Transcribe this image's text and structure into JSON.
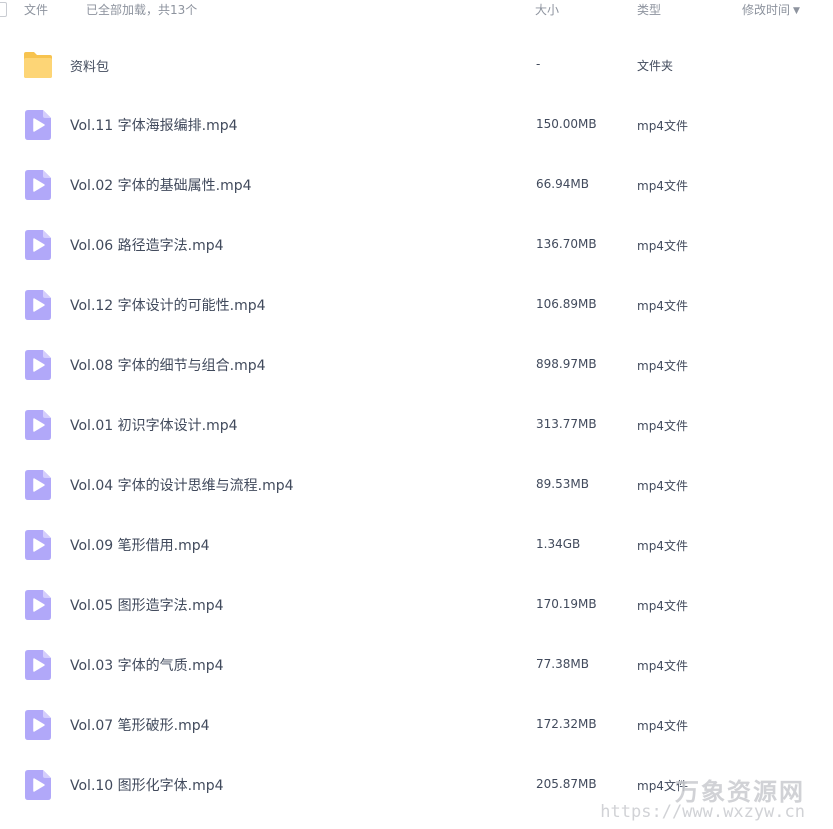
{
  "header": {
    "name_label": "文件",
    "count_text": "已全部加载，共13个",
    "size_label": "大小",
    "type_label": "类型",
    "date_label": "修改时间",
    "sort_icon": "sort-desc-icon"
  },
  "items": [
    {
      "name": "资料包",
      "size": "-",
      "type": "文件夹",
      "icon": "folder-icon"
    },
    {
      "name": "Vol.11 字体海报编排.mp4",
      "size": "150.00MB",
      "type": "mp4文件",
      "icon": "video-file-icon"
    },
    {
      "name": "Vol.02 字体的基础属性.mp4",
      "size": "66.94MB",
      "type": "mp4文件",
      "icon": "video-file-icon"
    },
    {
      "name": "Vol.06 路径造字法.mp4",
      "size": "136.70MB",
      "type": "mp4文件",
      "icon": "video-file-icon"
    },
    {
      "name": "Vol.12 字体设计的可能性.mp4",
      "size": "106.89MB",
      "type": "mp4文件",
      "icon": "video-file-icon"
    },
    {
      "name": "Vol.08 字体的细节与组合.mp4",
      "size": "898.97MB",
      "type": "mp4文件",
      "icon": "video-file-icon"
    },
    {
      "name": "Vol.01 初识字体设计.mp4",
      "size": "313.77MB",
      "type": "mp4文件",
      "icon": "video-file-icon"
    },
    {
      "name": "Vol.04 字体的设计思维与流程.mp4",
      "size": "89.53MB",
      "type": "mp4文件",
      "icon": "video-file-icon"
    },
    {
      "name": "Vol.09 笔形借用.mp4",
      "size": "1.34GB",
      "type": "mp4文件",
      "icon": "video-file-icon"
    },
    {
      "name": "Vol.05 图形造字法.mp4",
      "size": "170.19MB",
      "type": "mp4文件",
      "icon": "video-file-icon"
    },
    {
      "name": "Vol.03 字体的气质.mp4",
      "size": "77.38MB",
      "type": "mp4文件",
      "icon": "video-file-icon"
    },
    {
      "name": "Vol.07 笔形破形.mp4",
      "size": "172.32MB",
      "type": "mp4文件",
      "icon": "video-file-icon"
    },
    {
      "name": "Vol.10 图形化字体.mp4",
      "size": "205.87MB",
      "type": "mp4文件",
      "icon": "video-file-icon"
    }
  ],
  "watermark": {
    "title": "万象资源网",
    "url": "https://www.wxzyw.cn"
  },
  "colors": {
    "folder": "#fdd576",
    "video_icon": "#b1a8f9",
    "text": "#414a5c",
    "header_text": "#8d939e"
  }
}
